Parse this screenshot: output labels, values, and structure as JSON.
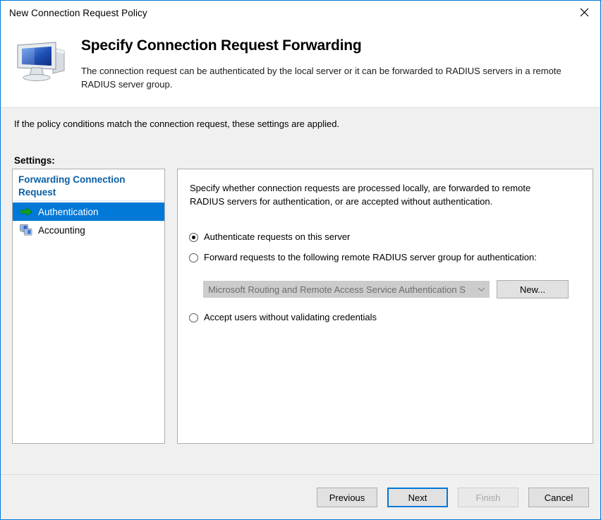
{
  "window": {
    "title": "New Connection Request Policy",
    "close_icon": "close-icon",
    "accent_color": "#0078d7",
    "border_color": "#0078d7",
    "background_color": "#f0f0f0"
  },
  "header": {
    "icon": "computer-monitor-icon",
    "title": "Specify Connection Request Forwarding",
    "description": "The connection request can be authenticated by the local server or it can be forwarded to RADIUS servers in a remote RADIUS server group."
  },
  "intro": {
    "text": "If the policy conditions match the connection request, these settings are applied."
  },
  "settings": {
    "label": "Settings:",
    "tree": {
      "group_header": "Forwarding Connection Request",
      "group_header_color": "#0a5fa5",
      "items": [
        {
          "label": "Authentication",
          "icon": "green-arrow-icon",
          "selected": true
        },
        {
          "label": "Accounting",
          "icon": "network-computers-icon",
          "selected": false
        }
      ]
    }
  },
  "content": {
    "description": "Specify whether connection requests are processed locally, are forwarded to remote RADIUS servers for authentication, or are accepted without authentication.",
    "radio_options": [
      {
        "id": "authenticate",
        "label": "Authenticate requests on this server",
        "checked": true
      },
      {
        "id": "forward",
        "label": "Forward requests to the following remote RADIUS server group for authentication:",
        "checked": false
      },
      {
        "id": "accept",
        "label": "Accept users without validating credentials",
        "checked": false
      }
    ],
    "server_group_combo": {
      "value": "Microsoft Routing and Remote Access Service Authentication S",
      "disabled": true,
      "arrow_icon": "chevron-down-icon"
    },
    "new_button": {
      "label": "New..."
    }
  },
  "footer": {
    "buttons": [
      {
        "id": "previous",
        "label": "Previous",
        "state": "normal"
      },
      {
        "id": "next",
        "label": "Next",
        "state": "default"
      },
      {
        "id": "finish",
        "label": "Finish",
        "state": "disabled"
      },
      {
        "id": "cancel",
        "label": "Cancel",
        "state": "normal"
      }
    ]
  }
}
